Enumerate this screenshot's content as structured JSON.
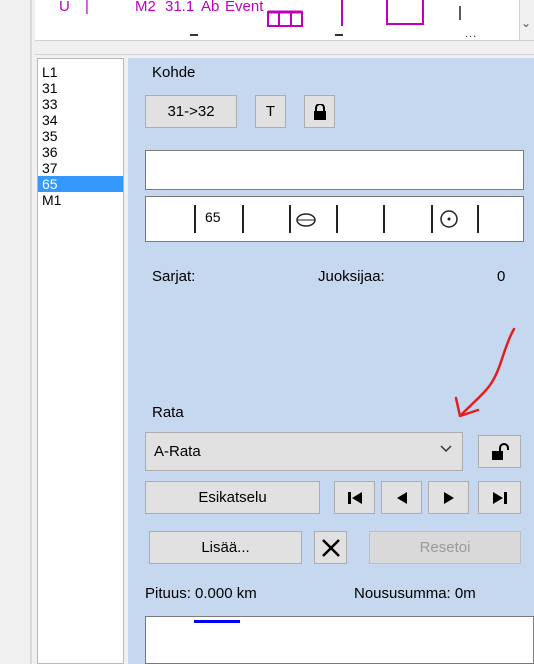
{
  "toolbar": {
    "symbols": [
      "U",
      "|",
      "M2",
      "31.1",
      "Ab",
      "Event"
    ]
  },
  "controls": {
    "items": [
      "L1",
      "31",
      "33",
      "34",
      "35",
      "36",
      "37",
      "65",
      "M1"
    ],
    "selected": "65"
  },
  "kohde": {
    "title": "Kohde",
    "leg_button": "31->32",
    "t_button": "T",
    "lock_icon": "lock-icon",
    "name_value": "",
    "code": "65",
    "sarjat_label": "Sarjat:",
    "runners_label": "Juoksijaa:",
    "runners_count": "0"
  },
  "rata": {
    "title": "Rata",
    "selected_course": "A-Rata",
    "preview_button": "Esikatselu",
    "add_button": "Lisää...",
    "reset_button": "Resetoi",
    "length_text": "Pituus: 0.000 km",
    "climb_text": "Noususumma: 0m"
  },
  "colors": {
    "panel_bg": "#c5d8ef",
    "selection": "#3399ff",
    "annotation_arrow": "#e02020"
  }
}
